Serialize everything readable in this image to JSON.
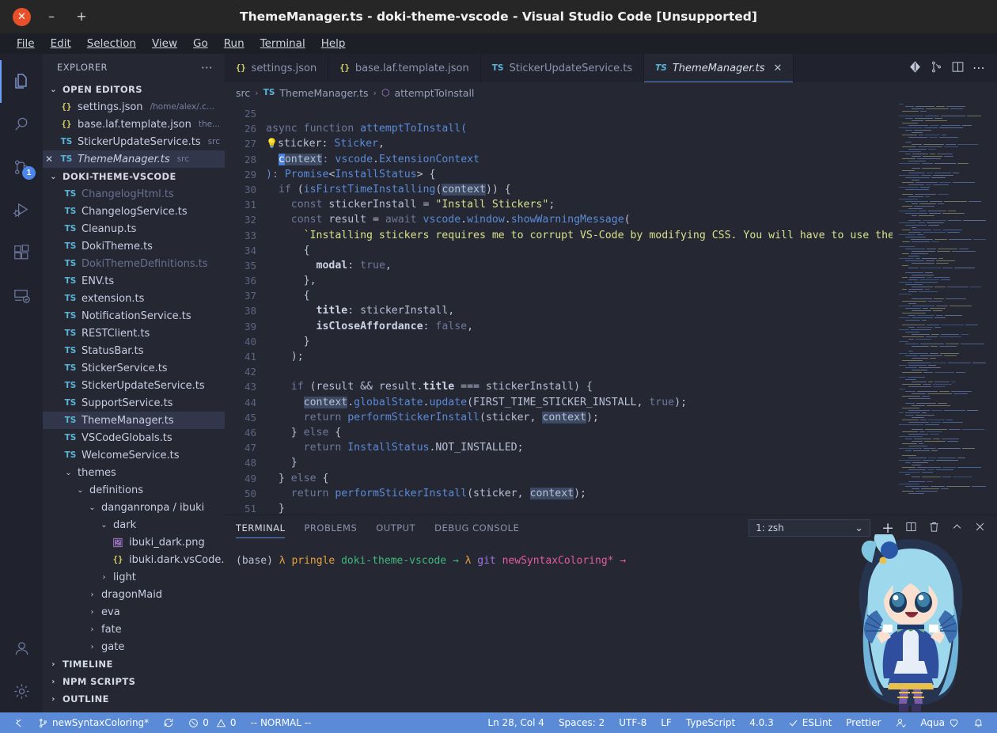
{
  "window": {
    "title": "ThemeManager.ts - doki-theme-vscode - Visual Studio Code [Unsupported]",
    "close_label": "✕",
    "minimize_label": "–",
    "maximize_label": "+"
  },
  "menubar": {
    "items": [
      {
        "label": "File"
      },
      {
        "label": "Edit"
      },
      {
        "label": "Selection"
      },
      {
        "label": "View"
      },
      {
        "label": "Go"
      },
      {
        "label": "Run"
      },
      {
        "label": "Terminal"
      },
      {
        "label": "Help"
      }
    ]
  },
  "activitybar": {
    "items": [
      {
        "name": "explorer",
        "icon": "files-icon",
        "active": true,
        "badge": ""
      },
      {
        "name": "search",
        "icon": "search-icon",
        "active": false,
        "badge": ""
      },
      {
        "name": "source-control",
        "icon": "source-control-icon",
        "active": false,
        "badge": "1"
      },
      {
        "name": "run-and-debug",
        "icon": "run-debug-icon",
        "active": false,
        "badge": ""
      },
      {
        "name": "extensions",
        "icon": "extensions-icon",
        "active": false,
        "badge": ""
      },
      {
        "name": "remote-explorer",
        "icon": "remote-explorer-icon",
        "active": false,
        "badge": ""
      },
      {
        "name": "accounts",
        "icon": "account-icon",
        "active": false,
        "badge": ""
      },
      {
        "name": "settings",
        "icon": "gear-icon",
        "active": false,
        "badge": ""
      }
    ]
  },
  "sidebar": {
    "title": "EXPLORER",
    "more_label": "⋯",
    "open_editors": {
      "label": "OPEN EDITORS",
      "expanded": true,
      "items": [
        {
          "name": "settings.json",
          "meta": "/home/alex/.c...",
          "icon": "json",
          "selected": false,
          "dirty": false,
          "dim": false,
          "italic": false
        },
        {
          "name": "base.laf.template.json",
          "meta": "the...",
          "icon": "json",
          "selected": false,
          "dirty": false,
          "dim": false,
          "italic": false
        },
        {
          "name": "StickerUpdateService.ts",
          "meta": "src",
          "icon": "ts",
          "selected": false,
          "dirty": false,
          "dim": false,
          "italic": false
        },
        {
          "name": "ThemeManager.ts",
          "meta": "src",
          "icon": "ts",
          "selected": true,
          "dirty": false,
          "dim": false,
          "italic": true,
          "close": "✕"
        }
      ]
    },
    "project": {
      "label": "DOKI-THEME-VSCODE",
      "expanded": true,
      "items": [
        {
          "name": "ChangelogHtml.ts",
          "icon": "ts",
          "indent": 1,
          "dim": true,
          "kind": "file"
        },
        {
          "name": "ChangelogService.ts",
          "icon": "ts",
          "indent": 1,
          "dim": false,
          "kind": "file"
        },
        {
          "name": "Cleanup.ts",
          "icon": "ts",
          "indent": 1,
          "dim": false,
          "kind": "file"
        },
        {
          "name": "DokiTheme.ts",
          "icon": "ts",
          "indent": 1,
          "dim": false,
          "kind": "file"
        },
        {
          "name": "DokiThemeDefinitions.ts",
          "icon": "ts",
          "indent": 1,
          "dim": true,
          "kind": "file"
        },
        {
          "name": "ENV.ts",
          "icon": "ts",
          "indent": 1,
          "dim": false,
          "kind": "file"
        },
        {
          "name": "extension.ts",
          "icon": "ts",
          "indent": 1,
          "dim": false,
          "kind": "file"
        },
        {
          "name": "NotificationService.ts",
          "icon": "ts",
          "indent": 1,
          "dim": false,
          "kind": "file"
        },
        {
          "name": "RESTClient.ts",
          "icon": "ts",
          "indent": 1,
          "dim": false,
          "kind": "file"
        },
        {
          "name": "StatusBar.ts",
          "icon": "ts",
          "indent": 1,
          "dim": false,
          "kind": "file"
        },
        {
          "name": "StickerService.ts",
          "icon": "ts",
          "indent": 1,
          "dim": false,
          "kind": "file"
        },
        {
          "name": "StickerUpdateService.ts",
          "icon": "ts",
          "indent": 1,
          "dim": false,
          "kind": "file"
        },
        {
          "name": "SupportService.ts",
          "icon": "ts",
          "indent": 1,
          "dim": false,
          "kind": "file"
        },
        {
          "name": "ThemeManager.ts",
          "icon": "ts",
          "indent": 1,
          "dim": false,
          "kind": "file",
          "selected": true
        },
        {
          "name": "VSCodeGlobals.ts",
          "icon": "ts",
          "indent": 1,
          "dim": false,
          "kind": "file"
        },
        {
          "name": "WelcomeService.ts",
          "icon": "ts",
          "indent": 1,
          "dim": false,
          "kind": "file"
        },
        {
          "name": "themes",
          "icon": "folder",
          "indent": 1,
          "dim": false,
          "kind": "folder",
          "expanded": true
        },
        {
          "name": "definitions",
          "icon": "folder",
          "indent": 2,
          "dim": false,
          "kind": "folder",
          "expanded": true
        },
        {
          "name": "danganronpa / ibuki",
          "icon": "folder",
          "indent": 3,
          "dim": false,
          "kind": "folder",
          "expanded": true
        },
        {
          "name": "dark",
          "icon": "folder",
          "indent": 4,
          "dim": false,
          "kind": "folder",
          "expanded": true
        },
        {
          "name": "ibuki_dark.png",
          "icon": "png",
          "indent": 5,
          "dim": false,
          "kind": "file"
        },
        {
          "name": "ibuki.dark.vsCode.definit...",
          "icon": "json",
          "indent": 5,
          "dim": false,
          "kind": "file"
        },
        {
          "name": "light",
          "icon": "folder",
          "indent": 4,
          "dim": false,
          "kind": "folder",
          "expanded": false
        },
        {
          "name": "dragonMaid",
          "icon": "folder",
          "indent": 3,
          "dim": false,
          "kind": "folder",
          "expanded": false
        },
        {
          "name": "eva",
          "icon": "folder",
          "indent": 3,
          "dim": false,
          "kind": "folder",
          "expanded": false
        },
        {
          "name": "fate",
          "icon": "folder",
          "indent": 3,
          "dim": false,
          "kind": "folder",
          "expanded": false
        },
        {
          "name": "gate",
          "icon": "folder",
          "indent": 3,
          "dim": false,
          "kind": "folder",
          "expanded": false
        }
      ]
    },
    "bottom_sections": [
      {
        "label": "TIMELINE",
        "expanded": false
      },
      {
        "label": "NPM SCRIPTS",
        "expanded": false
      },
      {
        "label": "OUTLINE",
        "expanded": false
      }
    ]
  },
  "editor": {
    "tabs": [
      {
        "label": "settings.json",
        "icon": "json",
        "active": false
      },
      {
        "label": "base.laf.template.json",
        "icon": "json",
        "active": false
      },
      {
        "label": "StickerUpdateService.ts",
        "icon": "ts",
        "active": false
      },
      {
        "label": "ThemeManager.ts",
        "icon": "ts",
        "active": true,
        "close": "✕"
      }
    ],
    "actions": [
      {
        "name": "source-control-graph-icon"
      },
      {
        "name": "split-diff-icon"
      },
      {
        "name": "split-editor-icon"
      },
      {
        "name": "more-actions-icon",
        "label": "⋯"
      }
    ],
    "breadcrumb": [
      "src",
      "ThemeManager.ts",
      "attemptToInstall"
    ],
    "first_line_number": 25,
    "lines": [
      {
        "n": 25,
        "text": ""
      },
      {
        "n": 26,
        "text": "async function attemptToInstall("
      },
      {
        "n": 27,
        "text": "  sticker: Sticker,"
      },
      {
        "n": 28,
        "text": "  context: vscode.ExtensionContext"
      },
      {
        "n": 29,
        "text": "): Promise<InstallStatus> {"
      },
      {
        "n": 30,
        "text": "  if (isFirstTimeInstalling(context)) {"
      },
      {
        "n": 31,
        "text": "    const stickerInstall = \"Install Stickers\";"
      },
      {
        "n": 32,
        "text": "    const result = await vscode.window.showWarningMessage("
      },
      {
        "n": 33,
        "text": "      `Installing stickers requires me to corrupt VS-Code by modifying CSS. You will have to use the"
      },
      {
        "n": 34,
        "text": "      {"
      },
      {
        "n": 35,
        "text": "        modal: true,"
      },
      {
        "n": 36,
        "text": "      },"
      },
      {
        "n": 37,
        "text": "      {"
      },
      {
        "n": 38,
        "text": "        title: stickerInstall,"
      },
      {
        "n": 39,
        "text": "        isCloseAffordance: false,"
      },
      {
        "n": 40,
        "text": "      }"
      },
      {
        "n": 41,
        "text": "    );"
      },
      {
        "n": 42,
        "text": ""
      },
      {
        "n": 43,
        "text": "    if (result && result.title === stickerInstall) {"
      },
      {
        "n": 44,
        "text": "      context.globalState.update(FIRST_TIME_STICKER_INSTALL, true);"
      },
      {
        "n": 45,
        "text": "      return performStickerInstall(sticker, context);"
      },
      {
        "n": 46,
        "text": "    } else {"
      },
      {
        "n": 47,
        "text": "      return InstallStatus.NOT_INSTALLED;"
      },
      {
        "n": 48,
        "text": "    }"
      },
      {
        "n": 49,
        "text": "  } else {"
      },
      {
        "n": 50,
        "text": "    return performStickerInstall(sticker, context);"
      },
      {
        "n": 51,
        "text": "  }"
      }
    ]
  },
  "panel": {
    "tabs": [
      {
        "label": "TERMINAL",
        "active": true
      },
      {
        "label": "PROBLEMS",
        "active": false
      },
      {
        "label": "OUTPUT",
        "active": false
      },
      {
        "label": "DEBUG CONSOLE",
        "active": false
      }
    ],
    "terminal_select": {
      "value": "1: zsh",
      "chevron": "⌄"
    },
    "actions": [
      {
        "name": "new-terminal-icon",
        "label": "+"
      },
      {
        "name": "split-terminal-icon"
      },
      {
        "name": "kill-terminal-icon"
      },
      {
        "name": "maximize-panel-icon"
      },
      {
        "name": "close-panel-icon"
      }
    ],
    "prompt": {
      "env": "(base)",
      "lambda1": "λ",
      "user": "pringle",
      "dir": "doki-theme-vscode",
      "arrow1": "→",
      "lambda2": "λ",
      "git": "git",
      "branch": "newSyntaxColoring*",
      "arrow2": "→"
    }
  },
  "statusbar": {
    "left": [
      {
        "name": "remote-indicator",
        "label": ""
      },
      {
        "name": "branch",
        "label": "newSyntaxColoring*"
      },
      {
        "name": "sync",
        "label": ""
      },
      {
        "name": "problems",
        "errors": "0",
        "warnings": "0"
      },
      {
        "name": "vim-mode",
        "label": "-- NORMAL --"
      }
    ],
    "right": [
      {
        "name": "cursor-position",
        "label": "Ln 28, Col 4"
      },
      {
        "name": "indentation",
        "label": "Spaces: 2"
      },
      {
        "name": "encoding",
        "label": "UTF-8"
      },
      {
        "name": "eol",
        "label": "LF"
      },
      {
        "name": "language-mode",
        "label": "TypeScript"
      },
      {
        "name": "ts-version",
        "label": "4.0.3"
      },
      {
        "name": "eslint",
        "label": "ESLint"
      },
      {
        "name": "prettier",
        "label": "Prettier"
      },
      {
        "name": "remote-dev",
        "label": ""
      },
      {
        "name": "doki-theme",
        "label": "Aqua"
      },
      {
        "name": "notifications",
        "label": ""
      }
    ],
    "accent_color": "#5b8bd6"
  },
  "sticker": {
    "name": "aqua-chibi-sticker",
    "character": "Aqua"
  }
}
